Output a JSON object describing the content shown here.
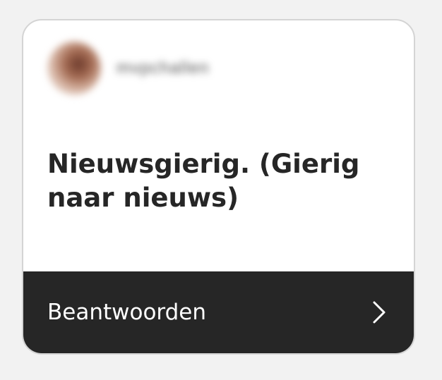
{
  "card": {
    "username": "mvpchallen",
    "question": "Nieuwsgierig. (Gierig naar nieuws)",
    "answer_label": "Beantwoorden",
    "colors": {
      "answer_bar_bg": "#262626",
      "card_bg": "#ffffff",
      "text": "#262626"
    },
    "icons": {
      "answer_arrow": "chevron-right-icon"
    }
  }
}
